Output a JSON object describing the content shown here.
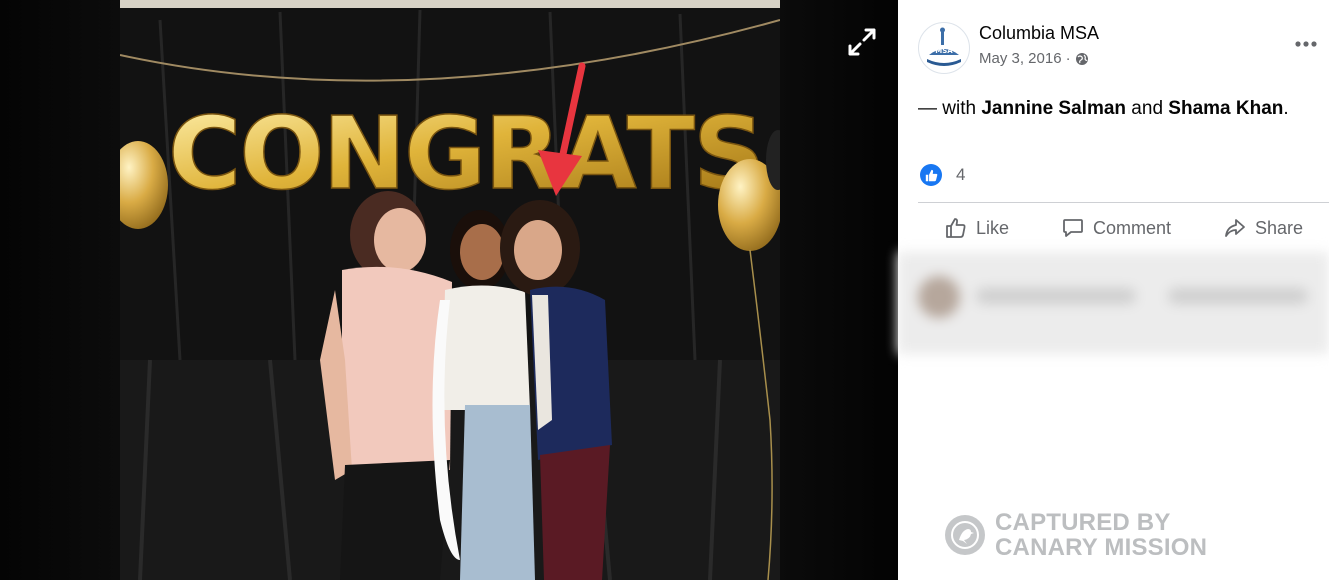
{
  "post": {
    "page_name": "Columbia MSA",
    "date": "May 3, 2016",
    "separator": "·",
    "caption_prefix": "— with ",
    "tagged_1": "Jannine Salman",
    "caption_join": " and ",
    "tagged_2": "Shama Khan",
    "caption_end": ".",
    "reaction_count": "4"
  },
  "avatar": {
    "logo_text": "MSA"
  },
  "actions": {
    "like": "Like",
    "comment": "Comment",
    "share": "Share"
  },
  "photo": {
    "banner_text": "CONGRATS"
  },
  "watermark": {
    "line1": "CAPTURED BY",
    "line2": "CANARY MISSION"
  },
  "icons": {
    "expand": "expand-icon",
    "more": "more-options-icon",
    "privacy": "globe-icon",
    "like": "thumbs-up-icon",
    "comment": "comment-icon",
    "share": "share-icon"
  },
  "colors": {
    "facebook_blue": "#1877f2",
    "arrow_red": "#e8353f",
    "balloon_gold": "#d9a926"
  }
}
